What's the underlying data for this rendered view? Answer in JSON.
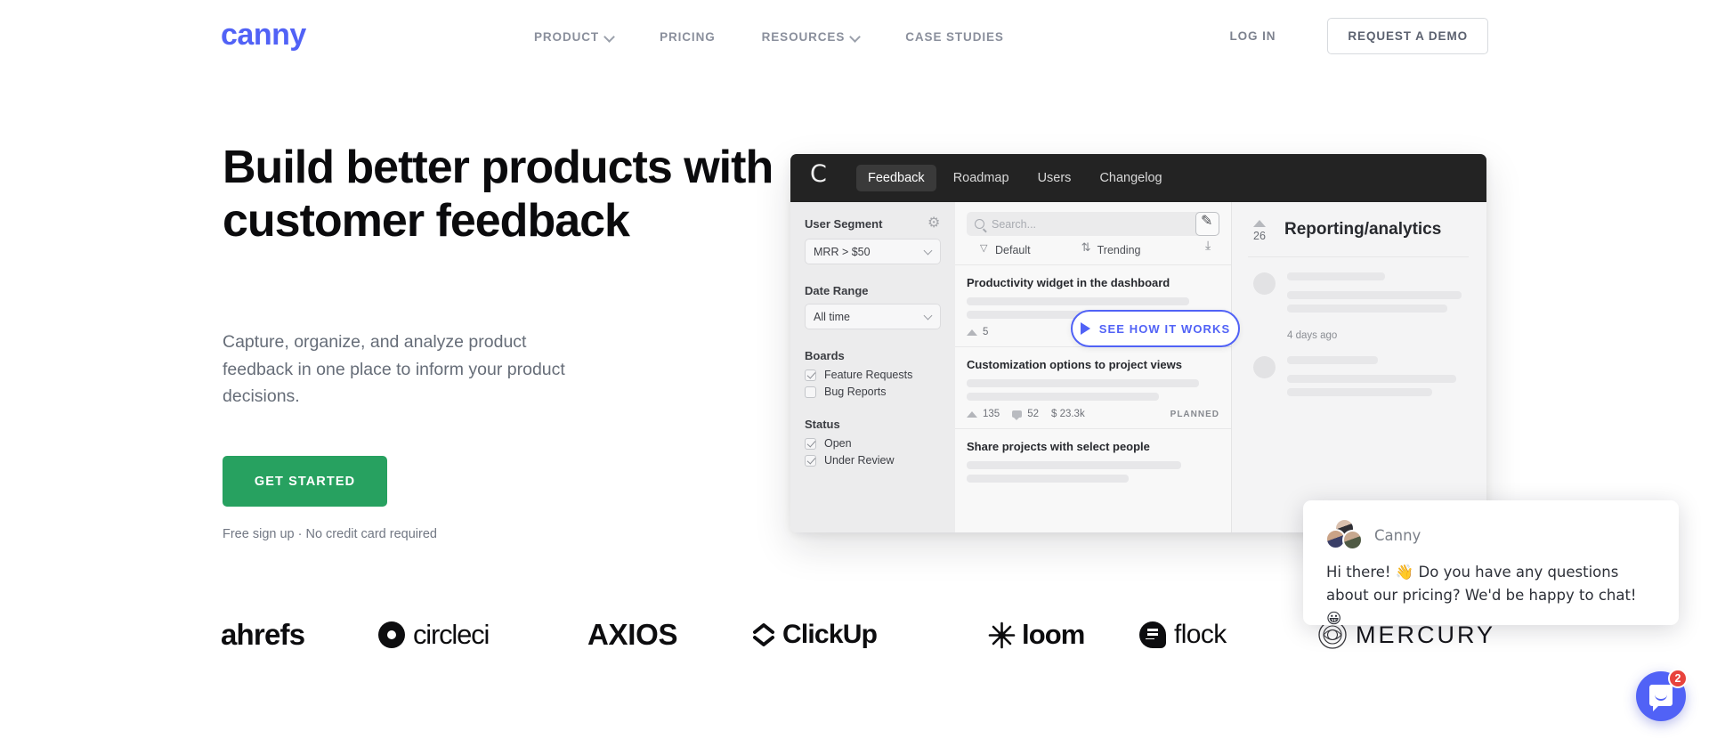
{
  "brand": {
    "logo_text": "canny",
    "accent_color": "#5162f6",
    "cta_color": "#27a160"
  },
  "nav": {
    "links": [
      {
        "label": "PRODUCT",
        "has_chevron": true
      },
      {
        "label": "PRICING",
        "has_chevron": false
      },
      {
        "label": "RESOURCES",
        "has_chevron": true
      },
      {
        "label": "CASE STUDIES",
        "has_chevron": false
      }
    ],
    "login_label": "LOG IN",
    "demo_label": "REQUEST A DEMO"
  },
  "hero": {
    "title": "Build better products with\ncustomer feedback",
    "subtitle": "Capture, organize, and analyze product feedback in one place to inform your product decisions.",
    "cta_label": "GET STARTED",
    "note": "Free sign up · No credit card required"
  },
  "mockup": {
    "logo_letter": "C",
    "tabs": [
      {
        "label": "Feedback",
        "active": true
      },
      {
        "label": "Roadmap",
        "active": false
      },
      {
        "label": "Users",
        "active": false
      },
      {
        "label": "Changelog",
        "active": false
      }
    ],
    "sidebar": {
      "user_segment_label": "User Segment",
      "user_segment_value": "MRR > $50",
      "date_range_label": "Date Range",
      "date_range_value": "All time",
      "boards_label": "Boards",
      "boards": [
        {
          "label": "Feature Requests",
          "checked": true
        },
        {
          "label": "Bug Reports",
          "checked": false
        }
      ],
      "status_label": "Status",
      "statuses": [
        {
          "label": "Open",
          "checked": true
        },
        {
          "label": "Under Review",
          "checked": true
        }
      ]
    },
    "feed": {
      "search_placeholder": "Search...",
      "filter_label": "Default",
      "sort_label": "Trending",
      "posts": [
        {
          "title": "Productivity widget in the dashboard",
          "votes": "5",
          "comments": "",
          "revenue": "",
          "status": ""
        },
        {
          "title": "Customization options to project views",
          "votes": "135",
          "comments": "52",
          "revenue": "$ 23.3k",
          "status": "PLANNED"
        },
        {
          "title": "Share projects with select people",
          "votes": "",
          "comments": "",
          "revenue": "",
          "status": ""
        }
      ]
    },
    "detail": {
      "votes": "26",
      "title": "Reporting/analytics",
      "timestamp": "4 days ago"
    },
    "video_button_label": "SEE HOW IT WORKS"
  },
  "logos": [
    {
      "name": "ahrefs"
    },
    {
      "name": "circleci"
    },
    {
      "name": "AXIOS"
    },
    {
      "name": "ClickUp"
    },
    {
      "name": "loom"
    },
    {
      "name": "flock"
    },
    {
      "name": "MERCURY"
    }
  ],
  "chat": {
    "sender": "Canny",
    "message": "Hi there! 👋 Do you have any questions about our pricing? We'd be happy to chat! 😀",
    "badge_count": "2"
  }
}
